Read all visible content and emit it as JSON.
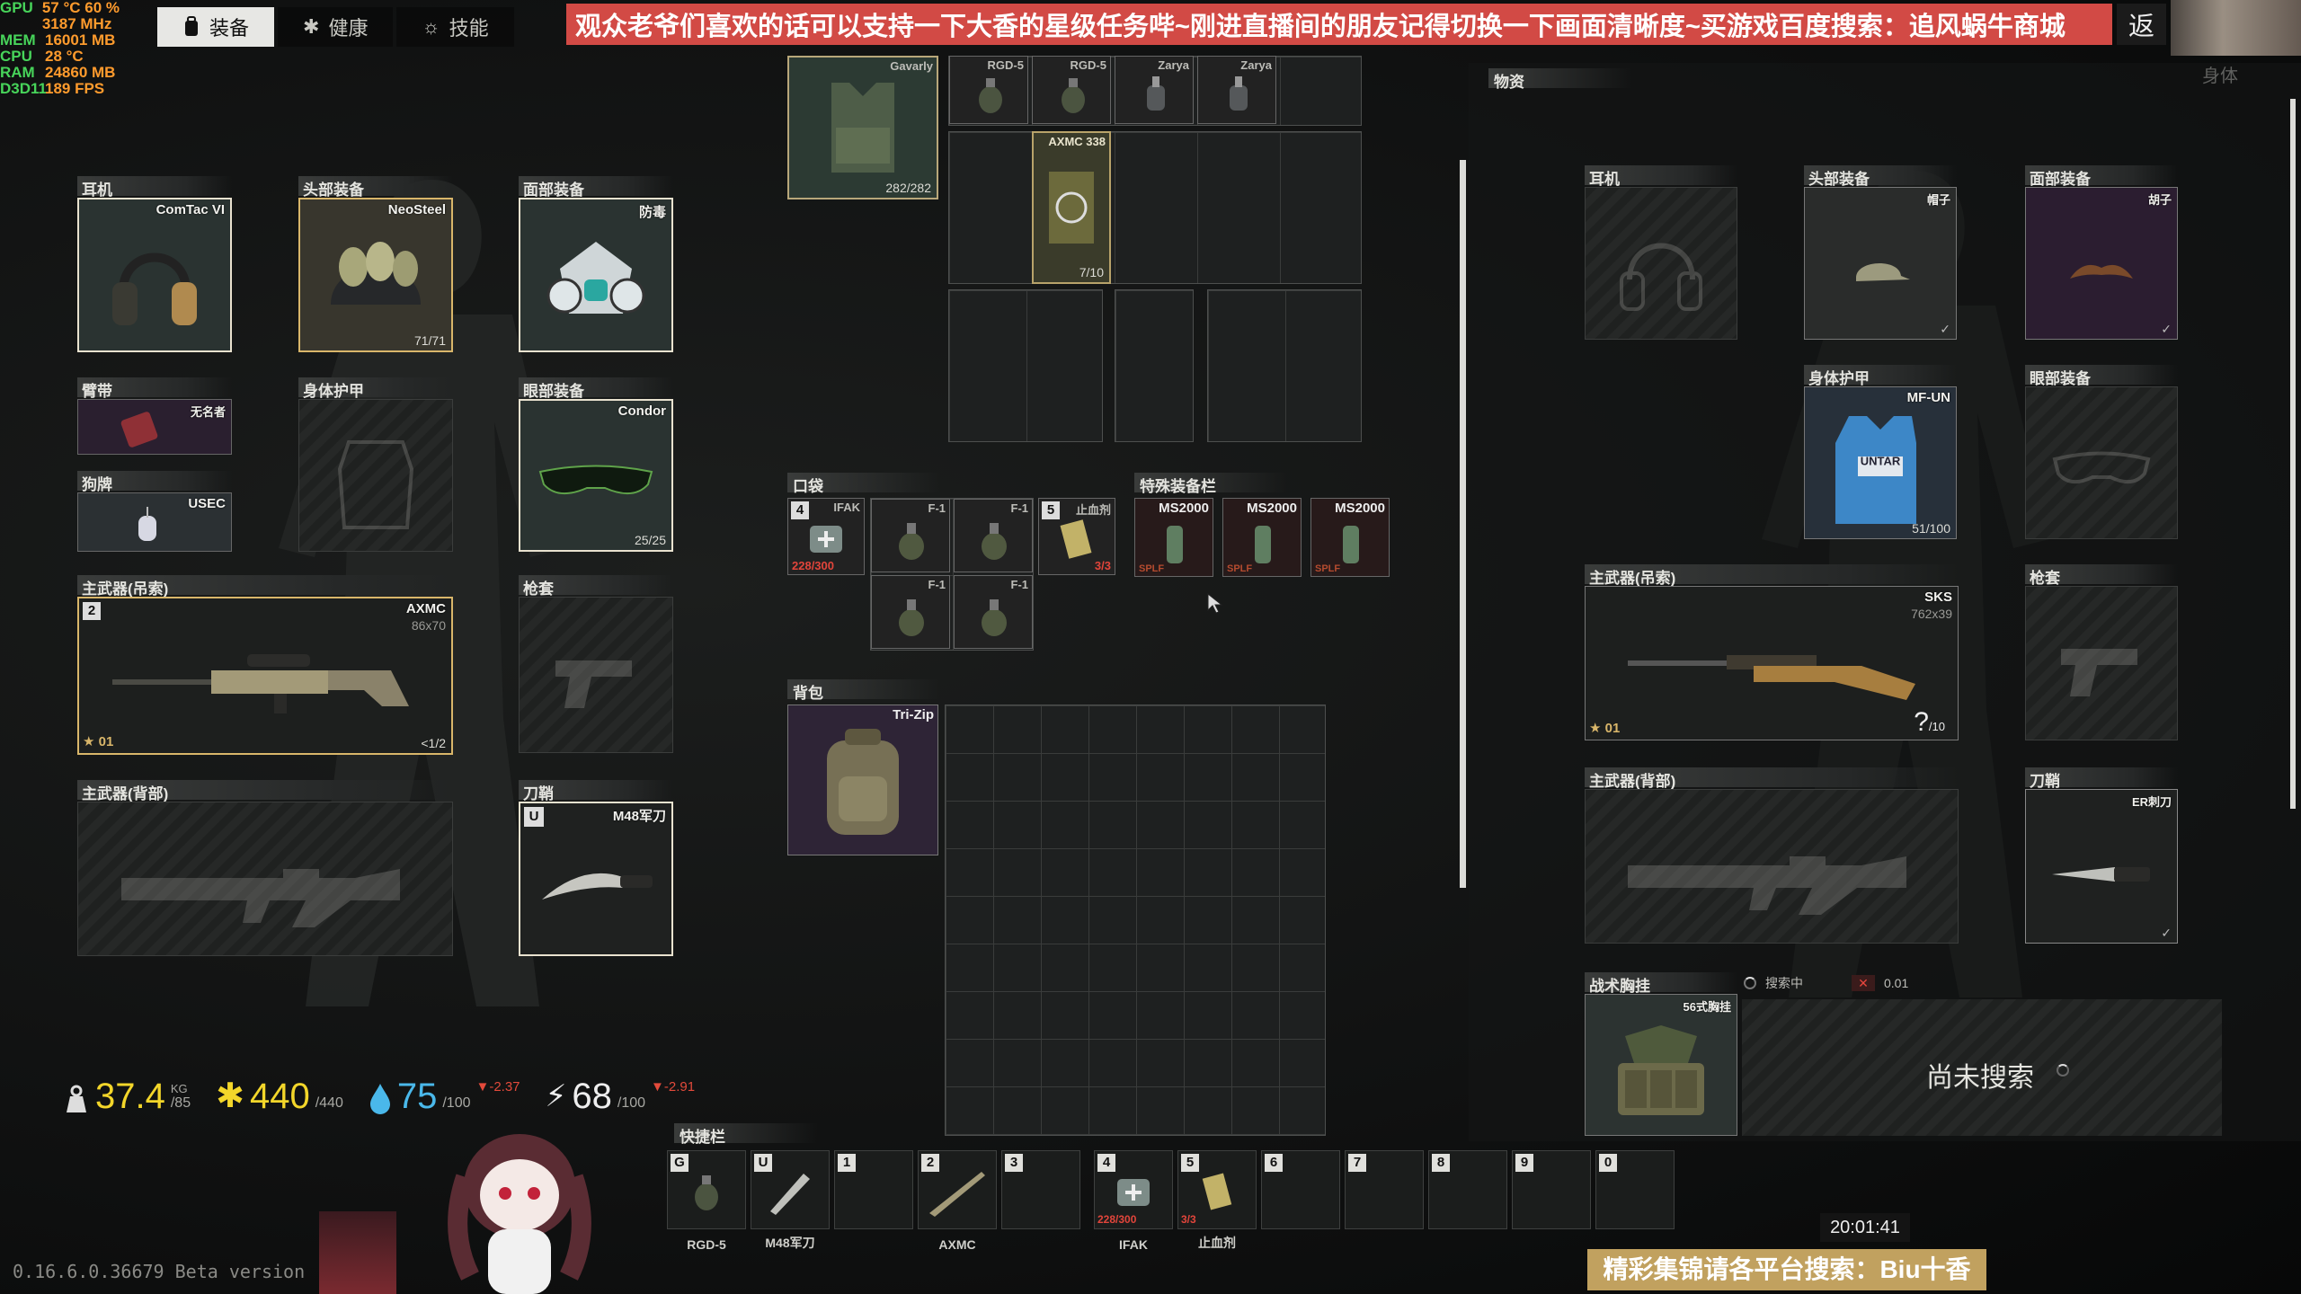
{
  "osd": {
    "rows": [
      {
        "k": "GPU",
        "v": "57 °C   60 %   3187 MHz"
      },
      {
        "k": "MEM",
        "v": "16001 MB"
      },
      {
        "k": "CPU",
        "v": "28 °C"
      },
      {
        "k": "RAM",
        "v": "24860 MB"
      },
      {
        "k": "D3D11",
        "v": "189 FPS"
      }
    ]
  },
  "tabs": [
    {
      "label": "装备",
      "active": true
    },
    {
      "label": "健康",
      "active": false
    },
    {
      "label": "技能",
      "active": false
    }
  ],
  "banner": {
    "text": "观众老爷们喜欢的话可以支持一下大香的星级任务哔~刚进直播间的朋友记得切换一下画面清晰度~买游戏百度搜索：追风蜗牛商城",
    "back": "返"
  },
  "right_title": "身体",
  "left_gear": {
    "headset": {
      "label": "耳机",
      "item": "ComTac VI"
    },
    "headwear": {
      "label": "头部装备",
      "item": "NeoSteel",
      "dur": "71/71"
    },
    "face": {
      "label": "面部装备",
      "item": "防毒"
    },
    "armband": {
      "label": "臂带",
      "item": "无名者"
    },
    "body_armor": {
      "label": "身体护甲"
    },
    "eyewear": {
      "label": "眼部装备",
      "item": "Condor",
      "dur": "25/25"
    },
    "dogtag": {
      "label": "狗牌",
      "item": "USEC"
    },
    "primary_sling": {
      "label": "主武器(吊索)",
      "item": "AXMC",
      "sub": "86x70",
      "slot_no": "2",
      "level": "01",
      "mag": "<1/2"
    },
    "holster": {
      "label": "枪套"
    },
    "primary_back": {
      "label": "主武器(背部)"
    },
    "sheath": {
      "label": "刀鞘",
      "item": "M48军刀",
      "key": "U"
    }
  },
  "middle": {
    "rig": {
      "name": "Gavarly",
      "dur": "282/282"
    },
    "rig_top_items": [
      "RGD-5",
      "RGD-5",
      "Zarya",
      "Zarya"
    ],
    "mag": {
      "name": "AXMC 338",
      "count": "7/10"
    },
    "pockets_label": "口袋",
    "pockets": {
      "ifak": {
        "name": "IFAK",
        "key": "4",
        "hp": "228/300"
      },
      "f1": [
        "F-1",
        "F-1",
        "F-1",
        "F-1"
      ],
      "tourniquet": {
        "name": "止血剂",
        "key": "5",
        "count": "3/3"
      }
    },
    "special_label": "特殊装备栏",
    "special": [
      "MS2000",
      "MS2000",
      "MS2000"
    ],
    "special_tag": "SPLF",
    "backpack_label": "背包",
    "backpack_item": "Tri-Zip"
  },
  "loot": {
    "title": "物资",
    "headset": {
      "label": "耳机"
    },
    "headwear": {
      "label": "头部装备",
      "item": "帽子"
    },
    "face": {
      "label": "面部装备",
      "item": "胡子"
    },
    "body_armor": {
      "label": "身体护甲",
      "item": "MF-UN",
      "dur": "51/100",
      "patch": "UNTAR"
    },
    "eyewear": {
      "label": "眼部装备"
    },
    "primary_sling": {
      "label": "主武器(吊索)",
      "item": "SKS",
      "sub": "762x39",
      "level": "01",
      "ammo": "?",
      "ammo_max": "/10"
    },
    "holster": {
      "label": "枪套"
    },
    "primary_back": {
      "label": "主武器(背部)"
    },
    "sheath": {
      "label": "刀鞘",
      "item": "ER刺刀"
    },
    "tac_rig": {
      "label": "战术胸挂",
      "item": "56式胸挂",
      "status": "搜索中",
      "timer": "0.01",
      "not_searched": "尚未搜索"
    }
  },
  "stats": {
    "weight": "37.4",
    "weight_unit": "KG",
    "weight_max": "/85",
    "health": "440",
    "health_max": "/440",
    "hydration": "75",
    "hydration_max": "/100",
    "hydration_delta": "▼-2.37",
    "energy": "68",
    "energy_max": "/100",
    "energy_delta": "▼-2.91"
  },
  "hotbar": {
    "label": "快捷栏",
    "slots": [
      {
        "key": "G",
        "label": "RGD-5"
      },
      {
        "key": "U",
        "label": "M48军刀"
      },
      {
        "key": "1",
        "label": ""
      },
      {
        "key": "2",
        "label": "AXMC"
      },
      {
        "key": "3",
        "label": ""
      },
      {
        "key": "4",
        "label": "IFAK",
        "red": "228/300"
      },
      {
        "key": "5",
        "label": "止血剂",
        "red": "3/3"
      },
      {
        "key": "6",
        "label": ""
      },
      {
        "key": "7",
        "label": ""
      },
      {
        "key": "8",
        "label": ""
      },
      {
        "key": "9",
        "label": ""
      },
      {
        "key": "0",
        "label": ""
      }
    ]
  },
  "footer": {
    "version": "0.16.6.0.36679 Beta version |",
    "clock": "20:01:41",
    "ad": "精彩集锦请各平台搜索：Biu十香"
  },
  "colors": {
    "accent_gold": "#d9b66a",
    "health": "#f3d62a",
    "hydration": "#4ab8ea",
    "banner": "#d24a45",
    "loss": "#e34a3b"
  }
}
